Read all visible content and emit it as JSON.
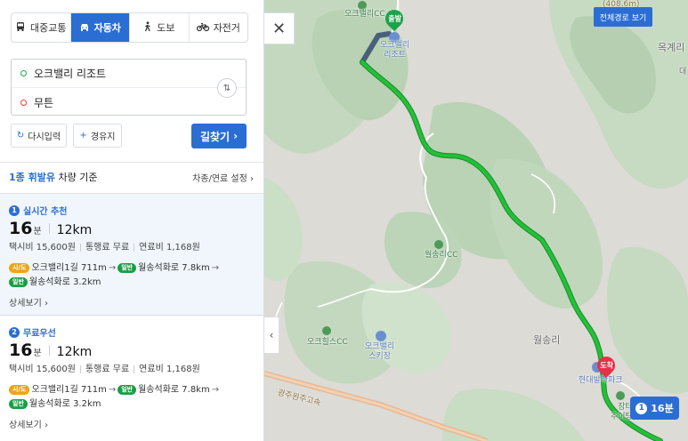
{
  "modes": [
    {
      "icon": "bus-icon",
      "label": "대중교통"
    },
    {
      "icon": "car-icon",
      "label": "자동차"
    },
    {
      "icon": "walk-icon",
      "label": "도보"
    },
    {
      "icon": "bike-icon",
      "label": "자전거"
    }
  ],
  "route": {
    "origin": "오크밸리 리조트",
    "destination": "무튼"
  },
  "actions": {
    "reset": "다시입력",
    "via": "경유지",
    "search": "길찾기"
  },
  "vehicle": {
    "type_link": "1종 휘발유",
    "type_suffix": "차량 기준",
    "settings": "차종/연료 설정"
  },
  "results": [
    {
      "num": "1",
      "label": "실시간 추천",
      "time": "16",
      "time_unit": "분",
      "distance": "12km",
      "taxi": "택시비 15,600원",
      "toll": "통행료 무료",
      "fuel": "연료비 1,168원",
      "road1_badge": "시/도",
      "road1": "오크밸리1길 711m",
      "road2_badge": "일반",
      "road2": "월송석화로 7.8km",
      "road3_badge": "일반",
      "road3": "월송석화로 3.2km",
      "details": "상세보기"
    },
    {
      "num": "2",
      "label": "무료우선",
      "time": "16",
      "time_unit": "분",
      "distance": "12km",
      "taxi": "택시비 15,600원",
      "toll": "통행료 무료",
      "fuel": "연료비 1,168원",
      "road1_badge": "시/도",
      "road1": "오크밸리1길 711m",
      "road2_badge": "일반",
      "road2": "월송석화로 7.8km",
      "road3_badge": "일반",
      "road3": "월송석화로 3.2km",
      "details": "상세보기"
    }
  ],
  "map": {
    "full_route_button": "전체경로 보기",
    "start_label": "출발",
    "end_label": "도착",
    "time_pill_num": "1",
    "time_pill": "16분",
    "labels": {
      "oak_cc": "오크밸리CC",
      "oak_resort": "오크밸리\n리조트",
      "oak_resort_a": "오크밸리",
      "oak_resort_b": "리조트",
      "wolsong_cc": "월송리CC",
      "oakhills_cc": "오크힐스CC",
      "ski_a": "오크밸리",
      "ski_b": "스키장",
      "wolsong_ri": "월송리",
      "okgye": "옥계리",
      "elevation": "(408.6m)",
      "daehan": "대",
      "gwangju_expy": "광주원주고속",
      "hyundai": "현대발라파크",
      "jangteo_a": "장터",
      "jangteo_b": "추어탕집"
    }
  }
}
